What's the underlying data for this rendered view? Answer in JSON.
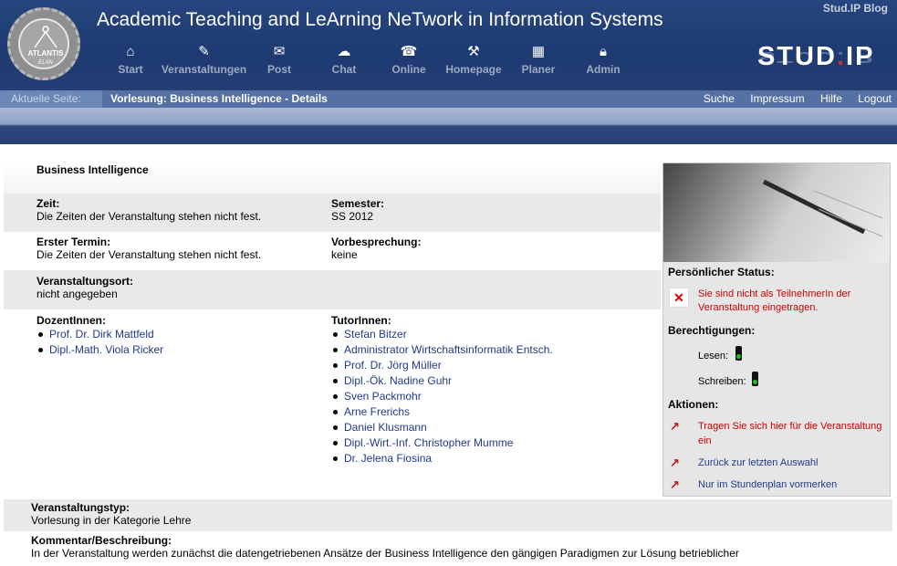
{
  "header": {
    "logo_text": "ATLANTIS",
    "logo_sub": "ELAN",
    "title": "Academic Teaching and LeArning NeTwork in Information Systems",
    "blog_link": "Stud.IP Blog",
    "brand_main": "STUD",
    "brand_dot": ".",
    "brand_tail": "IP",
    "nav": [
      {
        "label": "Start",
        "icon": "home-icon"
      },
      {
        "label": "Veranstaltungen",
        "icon": "courses-icon"
      },
      {
        "label": "Post",
        "icon": "mail-icon"
      },
      {
        "label": "Chat",
        "icon": "chat-icon"
      },
      {
        "label": "Online",
        "icon": "online-icon"
      },
      {
        "label": "Homepage",
        "icon": "tools-icon"
      },
      {
        "label": "Planer",
        "icon": "calendar-icon"
      },
      {
        "label": "Admin",
        "icon": "lock-icon"
      }
    ]
  },
  "crumb": {
    "label": "Aktuelle Seite:",
    "page": "Vorlesung: Business Intelligence - Details",
    "links": [
      "Suche",
      "Impressum",
      "Hilfe",
      "Logout"
    ]
  },
  "course": {
    "title": "Business Intelligence",
    "zeit_label": "Zeit:",
    "zeit_value": "Die Zeiten der Veranstaltung stehen nicht fest.",
    "semester_label": "Semester:",
    "semester_value": "SS 2012",
    "termin_label": "Erster Termin:",
    "termin_value": "Die Zeiten der Veranstaltung stehen nicht fest.",
    "vorbesprechung_label": "Vorbesprechung:",
    "vorbesprechung_value": "keine",
    "ort_label": "Veranstaltungsort:",
    "ort_value": "nicht angegeben",
    "dozenten_label": "DozentInnen:",
    "dozenten": [
      "Prof. Dr. Dirk Mattfeld",
      "Dipl.-Math. Viola Ricker"
    ],
    "tutoren_label": "TutorInnen:",
    "tutoren": [
      "Stefan Bitzer",
      "Administrator Wirtschaftsinformatik Entsch.",
      "Prof. Dr. Jörg Müller",
      "Dipl.-Ök. Nadine Guhr",
      "Sven Packmohr",
      "Arne Frerichs",
      "Daniel Klusmann",
      "Dipl.-Wirt.-Inf. Christopher Mumme",
      "Dr. Jelena Fiosina"
    ],
    "typ_label": "Veranstaltungstyp:",
    "typ_value": "Vorlesung in der Kategorie Lehre",
    "kommentar_label": "Kommentar/Beschreibung:",
    "kommentar_value": "In der Veranstaltung werden zunächst die datengetriebenen Ansätze der Business Intelligence den gängigen Paradigmen zur Lösung betrieblicher"
  },
  "sidebar": {
    "status_heading": "Persönlicher Status:",
    "status_text": "Sie sind nicht als TeilnehmerIn der Veranstaltung eingetragen.",
    "perm_heading": "Berechtigungen:",
    "lesen": "Lesen:",
    "schreiben": "Schreiben:",
    "actions_heading": "Aktionen:",
    "action_enroll": "Tragen Sie sich hier für die Veranstaltung ein",
    "action_back": "Zurück zur letzten Auswahl",
    "action_schedule": "Nur im Stundenplan vormerken"
  }
}
